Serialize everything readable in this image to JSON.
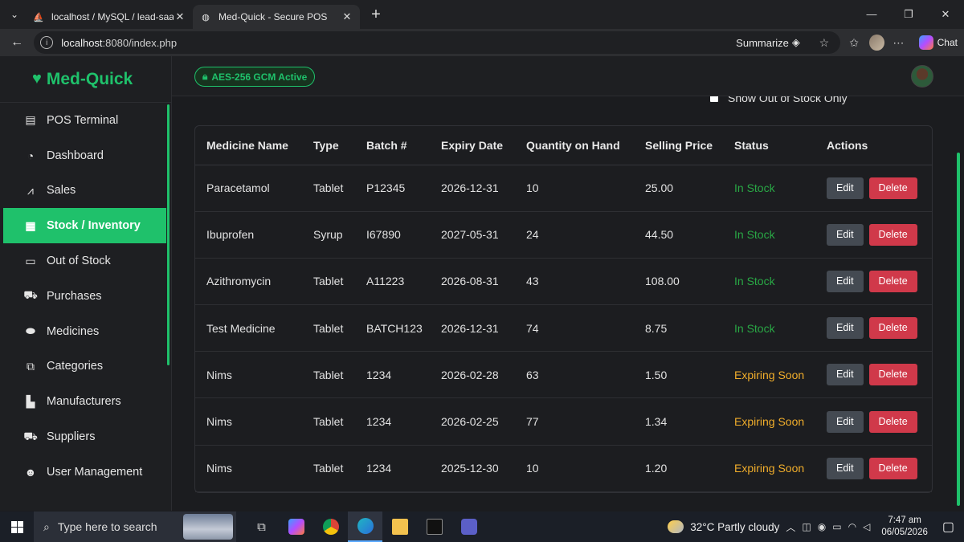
{
  "browser": {
    "tabs": [
      {
        "title": "localhost / MySQL / lead-saas / lea",
        "active": false
      },
      {
        "title": "Med-Quick - Secure POS",
        "active": true
      }
    ],
    "url_host": "localhost",
    "url_rest": ":8080/index.php",
    "summarize_label": "Summarize",
    "chat_label": "Chat"
  },
  "app": {
    "brand": "Med-Quick",
    "encryption_badge": "AES-256 GCM Active",
    "sidebar": [
      {
        "label": "POS Terminal",
        "icon": "cash-register-icon",
        "glyph": "▤"
      },
      {
        "label": "Dashboard",
        "icon": "gauge-icon",
        "glyph": "◔"
      },
      {
        "label": "Sales",
        "icon": "line-chart-icon",
        "glyph": "⩘"
      },
      {
        "label": "Stock / Inventory",
        "icon": "boxes-icon",
        "glyph": "▦",
        "active": true
      },
      {
        "label": "Out of Stock",
        "icon": "box-open-icon",
        "glyph": "▭"
      },
      {
        "label": "Purchases",
        "icon": "cart-icon",
        "glyph": "⛟"
      },
      {
        "label": "Medicines",
        "icon": "pills-icon",
        "glyph": "⬬"
      },
      {
        "label": "Categories",
        "icon": "sitemap-icon",
        "glyph": "⧉"
      },
      {
        "label": "Manufacturers",
        "icon": "industry-icon",
        "glyph": "▙"
      },
      {
        "label": "Suppliers",
        "icon": "truck-icon",
        "glyph": "⛟"
      },
      {
        "label": "User Management",
        "icon": "users-icon",
        "glyph": "☻"
      }
    ],
    "filter_label": "Show Out of Stock Only",
    "table": {
      "headers": [
        "Medicine Name",
        "Type",
        "Batch #",
        "Expiry Date",
        "Quantity on Hand",
        "Selling Price",
        "Status",
        "Actions"
      ],
      "rows": [
        {
          "name": "Paracetamol",
          "type": "Tablet",
          "batch": "P12345",
          "expiry": "2026-12-31",
          "qty": "10",
          "price": "25.00",
          "status": "In Stock"
        },
        {
          "name": "Ibuprofen",
          "type": "Syrup",
          "batch": "I67890",
          "expiry": "2027-05-31",
          "qty": "24",
          "price": "44.50",
          "status": "In Stock"
        },
        {
          "name": "Azithromycin",
          "type": "Tablet",
          "batch": "A11223",
          "expiry": "2026-08-31",
          "qty": "43",
          "price": "108.00",
          "status": "In Stock"
        },
        {
          "name": "Test Medicine",
          "type": "Tablet",
          "batch": "BATCH123",
          "expiry": "2026-12-31",
          "qty": "74",
          "price": "8.75",
          "status": "In Stock"
        },
        {
          "name": "Nims",
          "type": "Tablet",
          "batch": "1234",
          "expiry": "2026-02-28",
          "qty": "63",
          "price": "1.50",
          "status": "Expiring Soon"
        },
        {
          "name": "Nims",
          "type": "Tablet",
          "batch": "1234",
          "expiry": "2026-02-25",
          "qty": "77",
          "price": "1.34",
          "status": "Expiring Soon"
        },
        {
          "name": "Nims",
          "type": "Tablet",
          "batch": "1234",
          "expiry": "2025-12-30",
          "qty": "10",
          "price": "1.20",
          "status": "Expiring Soon"
        }
      ],
      "edit_label": "Edit",
      "delete_label": "Delete"
    },
    "colors": {
      "accent": "#1fc16b",
      "in_stock": "#29a845",
      "expiring": "#f0ad2b",
      "delete": "#d0394a"
    }
  },
  "taskbar": {
    "search_placeholder": "Type here to search",
    "weather": "32°C  Partly cloudy",
    "time": "7:47 am",
    "date": "06/05/2026"
  }
}
